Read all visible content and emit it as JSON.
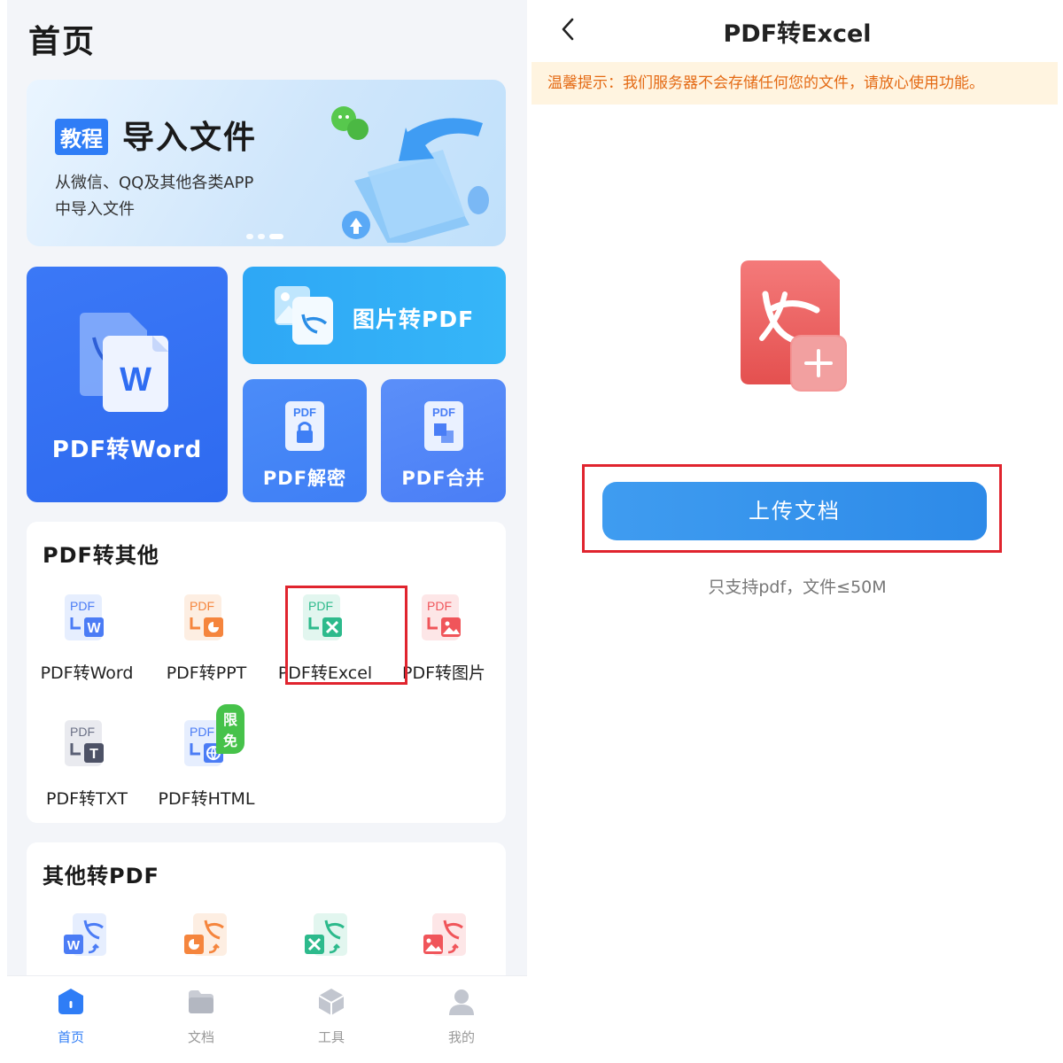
{
  "left": {
    "page_title": "首页",
    "banner": {
      "tag": "教程",
      "title": "导入文件",
      "subtitle_line1": "从微信、QQ及其他各类APP",
      "subtitle_line2": "中导入文件"
    },
    "tiles": {
      "word": "PDF转Word",
      "image": "图片转PDF",
      "decrypt": "PDF解密",
      "merge": "PDF合并"
    },
    "pdf_to_other": {
      "title": "PDF转其他",
      "items": [
        {
          "label": "PDF转Word",
          "icon": "pdf-to-word-icon",
          "color": "#4b7cf5"
        },
        {
          "label": "PDF转PPT",
          "icon": "pdf-to-ppt-icon",
          "color": "#f5853d"
        },
        {
          "label": "PDF转Excel",
          "icon": "pdf-to-excel-icon",
          "color": "#2dba8c"
        },
        {
          "label": "PDF转图片",
          "icon": "pdf-to-image-icon",
          "color": "#f0555a"
        },
        {
          "label": "PDF转TXT",
          "icon": "pdf-to-txt-icon",
          "color": "#5a6075"
        },
        {
          "label": "PDF转HTML",
          "icon": "pdf-to-html-icon",
          "color": "#4b7cf5",
          "badge": "限免"
        }
      ],
      "highlighted": "PDF转Excel"
    },
    "other_to_pdf": {
      "title": "其他转PDF"
    },
    "tabbar": [
      {
        "label": "首页",
        "icon": "home-icon",
        "active": true
      },
      {
        "label": "文档",
        "icon": "folder-icon",
        "active": false
      },
      {
        "label": "工具",
        "icon": "tools-icon",
        "active": false
      },
      {
        "label": "我的",
        "icon": "user-icon",
        "active": false
      }
    ]
  },
  "right": {
    "title": "PDF转Excel",
    "notice": "温馨提示：我们服务器不会存储任何您的文件，请放心使用功能。",
    "upload_button": "上传文档",
    "limit_text": "只支持pdf，文件≤50M"
  },
  "colors": {
    "accent": "#2f7df6",
    "highlight_border": "#e0242e",
    "notice_bg": "#fff4e0",
    "notice_text": "#e46a14",
    "badge": "#46c24a"
  }
}
